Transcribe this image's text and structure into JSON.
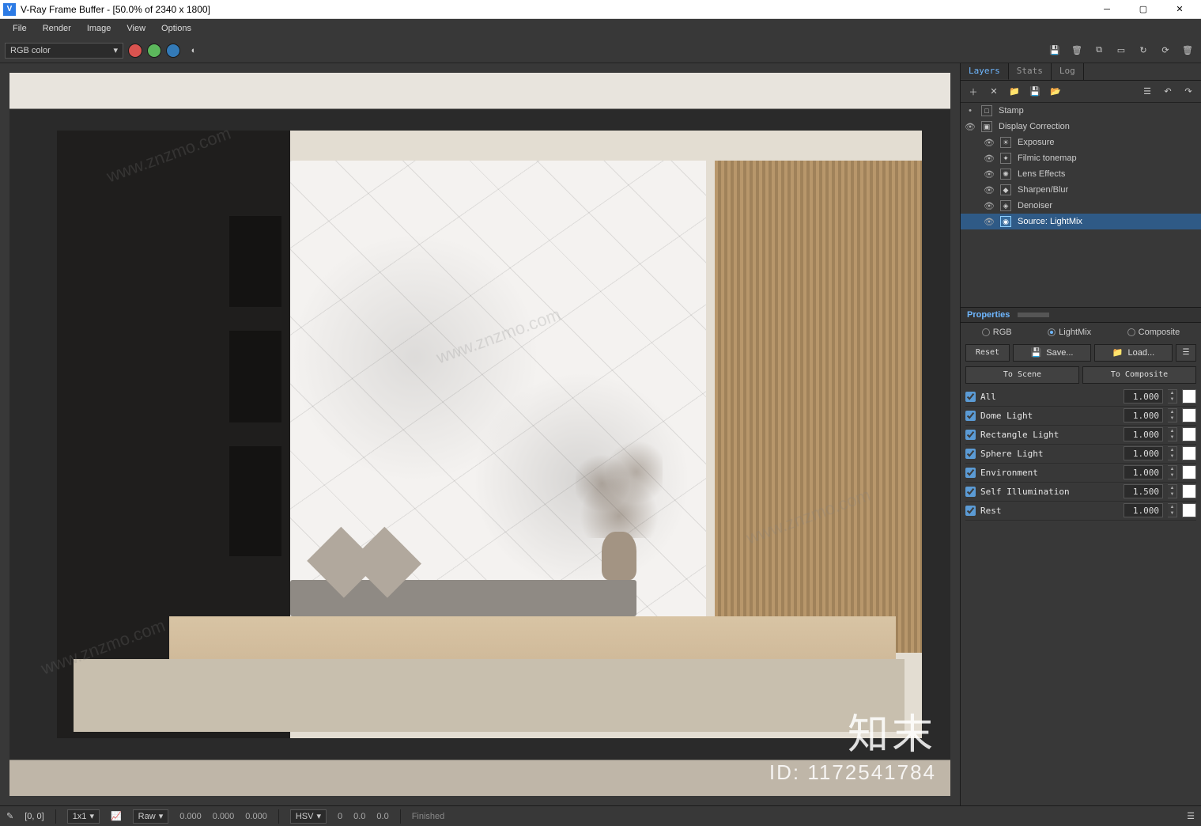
{
  "window": {
    "title": "V-Ray Frame Buffer - [50.0% of 2340 x 1800]"
  },
  "menu": {
    "file": "File",
    "render": "Render",
    "image": "Image",
    "view": "View",
    "options": "Options"
  },
  "toolbar": {
    "channel": "RGB color"
  },
  "sidepanel": {
    "tabs": {
      "layers": "Layers",
      "stats": "Stats",
      "log": "Log"
    },
    "layers": {
      "stamp": "Stamp",
      "display_correction": "Display Correction",
      "exposure": "Exposure",
      "filmic": "Filmic tonemap",
      "lens": "Lens Effects",
      "sharpen": "Sharpen/Blur",
      "denoiser": "Denoiser",
      "source": "Source: LightMix"
    },
    "properties_header": "Properties",
    "radios": {
      "rgb": "RGB",
      "lightmix": "LightMix",
      "composite": "Composite"
    },
    "buttons": {
      "reset": "Reset",
      "save": "Save...",
      "load": "Load...",
      "to_scene": "To Scene",
      "to_composite": "To Composite"
    },
    "lights": [
      {
        "name": "All",
        "value": "1.000"
      },
      {
        "name": "Dome Light",
        "value": "1.000"
      },
      {
        "name": "Rectangle Light",
        "value": "1.000"
      },
      {
        "name": "Sphere Light",
        "value": "1.000"
      },
      {
        "name": "Environment",
        "value": "1.000"
      },
      {
        "name": "Self Illumination",
        "value": "1.500"
      },
      {
        "name": "Rest",
        "value": "1.000"
      }
    ]
  },
  "statusbar": {
    "coords": "[0, 0]",
    "region": "1x1",
    "mode1": "Raw",
    "rgb_r": "0.000",
    "rgb_g": "0.000",
    "rgb_b": "0.000",
    "mode2": "HSV",
    "hsv_h": "0",
    "hsv_s": "0.0",
    "hsv_v": "0.0",
    "status": "Finished"
  },
  "watermark": {
    "brand": "知末",
    "id": "ID: 1172541784",
    "url": "www.znzmo.com"
  }
}
